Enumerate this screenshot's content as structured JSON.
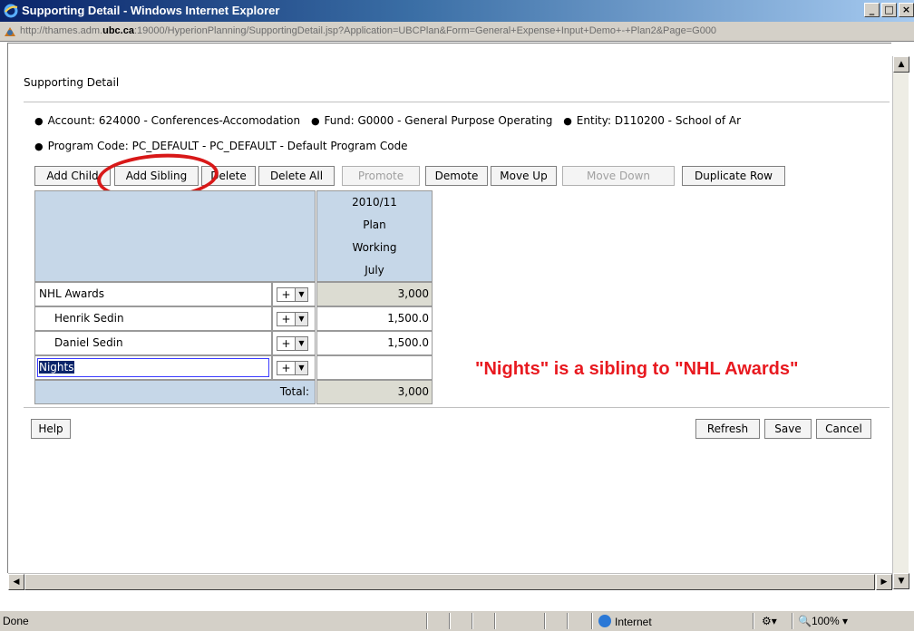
{
  "window": {
    "title": "Supporting Detail - Windows Internet Explorer",
    "url_prefix": "http://thames.adm.",
    "url_domain": "ubc.ca",
    "url_suffix": ":19000/HyperionPlanning/SupportingDetail.jsp?Application=UBCPlan&Form=General+Expense+Input+Demo+-+Plan2&Page=G000",
    "min": "_",
    "max": "□",
    "close": "×"
  },
  "page": {
    "title": "Supporting Detail",
    "pov": {
      "account": "Account: 624000 - Conferences-Accomodation",
      "fund": "Fund: G0000 - General Purpose Operating",
      "entity": "Entity: D110200 - School of Ar",
      "program": "Program Code: PC_DEFAULT - PC_DEFAULT - Default Program Code"
    }
  },
  "toolbar": {
    "add_child": "Add Child",
    "add_sibling": "Add Sibling",
    "delete": "Delete",
    "delete_all": "Delete All",
    "promote": "Promote",
    "demote": "Demote",
    "move_up": "Move Up",
    "move_down": "Move Down",
    "duplicate_row": "Duplicate Row"
  },
  "grid": {
    "header": [
      "2010/11",
      "Plan",
      "Working",
      "July"
    ],
    "rows": [
      {
        "label": "NHL Awards",
        "op": "+",
        "value": "3,000"
      },
      {
        "label": "Henrik Sedin",
        "op": "+",
        "value": "1,500.0"
      },
      {
        "label": "Daniel Sedin",
        "op": "+",
        "value": "1,500.0"
      },
      {
        "label": "Nights",
        "op": "+",
        "value": ""
      }
    ],
    "total_label": "Total:",
    "total_value": "3,000"
  },
  "annotation": "\"Nights\" is a sibling to \"NHL Awards\"",
  "bottom": {
    "help": "Help",
    "refresh": "Refresh",
    "save": "Save",
    "cancel": "Cancel"
  },
  "statusbar": {
    "status": "Done",
    "zone": "Internet",
    "zoom": "100%"
  },
  "colors": {
    "annotation": "#e8191f",
    "header_bg": "#c6d7e8",
    "calc_cell_bg": "#dcdcd2"
  }
}
